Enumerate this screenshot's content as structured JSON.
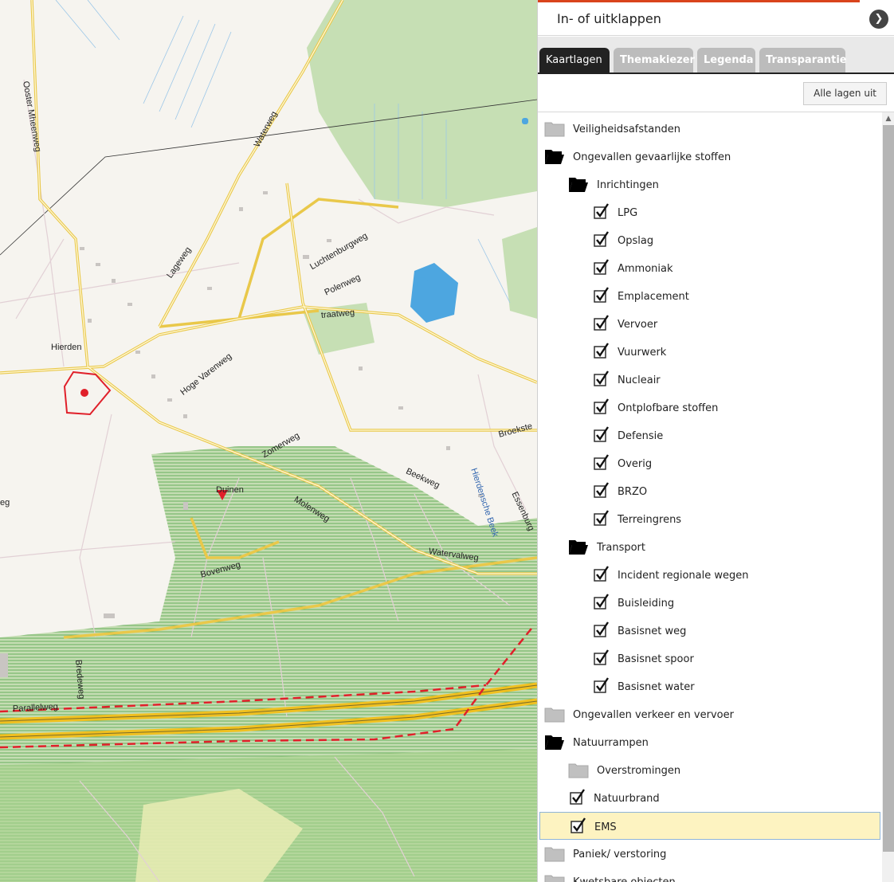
{
  "map": {
    "place_labels": [
      "Ooster Mheenweg",
      "Waterweg",
      "Lageweg",
      "Luchtenburgweg",
      "Polenweg",
      "traatweg",
      "Hierden",
      "Hoge Varenweg",
      "Zomerweg",
      "Beekweg",
      "Broekste",
      "Hierdensche Beek",
      "Essenburg",
      "Duinen",
      "Molenweg",
      "Watervalweg",
      "Bovenweg",
      "Bredeweg",
      "Parallelweg",
      "eg"
    ],
    "colors": {
      "background": "#f6f4ef",
      "forest": "#c2dcb0",
      "forest_hatch": "#5faa4e",
      "road": "#f2d96b",
      "highway": "#f0c020",
      "water": "#4da6e0",
      "hazard": "#e0202a"
    }
  },
  "panel": {
    "header_title": "In- of uitklappen",
    "toggle_icon": "chevron-right-icon",
    "tabs": [
      {
        "label": "Kaartlagen",
        "active": true
      },
      {
        "label": "Themakiezer",
        "active": false
      },
      {
        "label": "Legenda",
        "active": false
      },
      {
        "label": "Transparantie",
        "active": false
      }
    ],
    "all_layers_off_label": "Alle lagen uit",
    "tree": [
      {
        "label": "Veiligheidsafstanden",
        "type": "folder",
        "open": false,
        "level": 0,
        "highlighted": false
      },
      {
        "label": "Ongevallen gevaarlijke stoffen",
        "type": "folder",
        "open": true,
        "level": 0,
        "highlighted": false
      },
      {
        "label": "Inrichtingen",
        "type": "folder",
        "open": true,
        "level": 1,
        "highlighted": false
      },
      {
        "label": "LPG",
        "type": "checkbox",
        "checked": true,
        "level": 2,
        "highlighted": false
      },
      {
        "label": "Opslag",
        "type": "checkbox",
        "checked": true,
        "level": 2,
        "highlighted": false
      },
      {
        "label": "Ammoniak",
        "type": "checkbox",
        "checked": true,
        "level": 2,
        "highlighted": false
      },
      {
        "label": "Emplacement",
        "type": "checkbox",
        "checked": true,
        "level": 2,
        "highlighted": false
      },
      {
        "label": "Vervoer",
        "type": "checkbox",
        "checked": true,
        "level": 2,
        "highlighted": false
      },
      {
        "label": "Vuurwerk",
        "type": "checkbox",
        "checked": true,
        "level": 2,
        "highlighted": false
      },
      {
        "label": "Nucleair",
        "type": "checkbox",
        "checked": true,
        "level": 2,
        "highlighted": false
      },
      {
        "label": "Ontplofbare stoffen",
        "type": "checkbox",
        "checked": true,
        "level": 2,
        "highlighted": false
      },
      {
        "label": "Defensie",
        "type": "checkbox",
        "checked": true,
        "level": 2,
        "highlighted": false
      },
      {
        "label": "Overig",
        "type": "checkbox",
        "checked": true,
        "level": 2,
        "highlighted": false
      },
      {
        "label": "BRZO",
        "type": "checkbox",
        "checked": true,
        "level": 2,
        "highlighted": false
      },
      {
        "label": "Terreingrens",
        "type": "checkbox",
        "checked": true,
        "level": 2,
        "highlighted": false
      },
      {
        "label": "Transport",
        "type": "folder",
        "open": true,
        "level": 1,
        "highlighted": false
      },
      {
        "label": "Incident regionale wegen",
        "type": "checkbox",
        "checked": true,
        "level": 2,
        "highlighted": false
      },
      {
        "label": "Buisleiding",
        "type": "checkbox",
        "checked": true,
        "level": 2,
        "highlighted": false
      },
      {
        "label": "Basisnet weg",
        "type": "checkbox",
        "checked": true,
        "level": 2,
        "highlighted": false
      },
      {
        "label": "Basisnet spoor",
        "type": "checkbox",
        "checked": true,
        "level": 2,
        "highlighted": false
      },
      {
        "label": "Basisnet water",
        "type": "checkbox",
        "checked": true,
        "level": 2,
        "highlighted": false
      },
      {
        "label": "Ongevallen verkeer en vervoer",
        "type": "folder",
        "open": false,
        "level": 0,
        "highlighted": false
      },
      {
        "label": "Natuurrampen",
        "type": "folder",
        "open": true,
        "level": 0,
        "highlighted": false
      },
      {
        "label": "Overstromingen",
        "type": "folder",
        "open": false,
        "level": 1,
        "highlighted": false
      },
      {
        "label": "Natuurbrand",
        "type": "checkbox",
        "checked": true,
        "level": 1,
        "highlighted": false
      },
      {
        "label": "EMS",
        "type": "checkbox",
        "checked": true,
        "level": 1,
        "highlighted": true
      },
      {
        "label": "Paniek/ verstoring",
        "type": "folder",
        "open": false,
        "level": 0,
        "highlighted": false
      },
      {
        "label": "Kwetsbare objecten",
        "type": "folder",
        "open": false,
        "level": 0,
        "highlighted": false
      }
    ]
  }
}
